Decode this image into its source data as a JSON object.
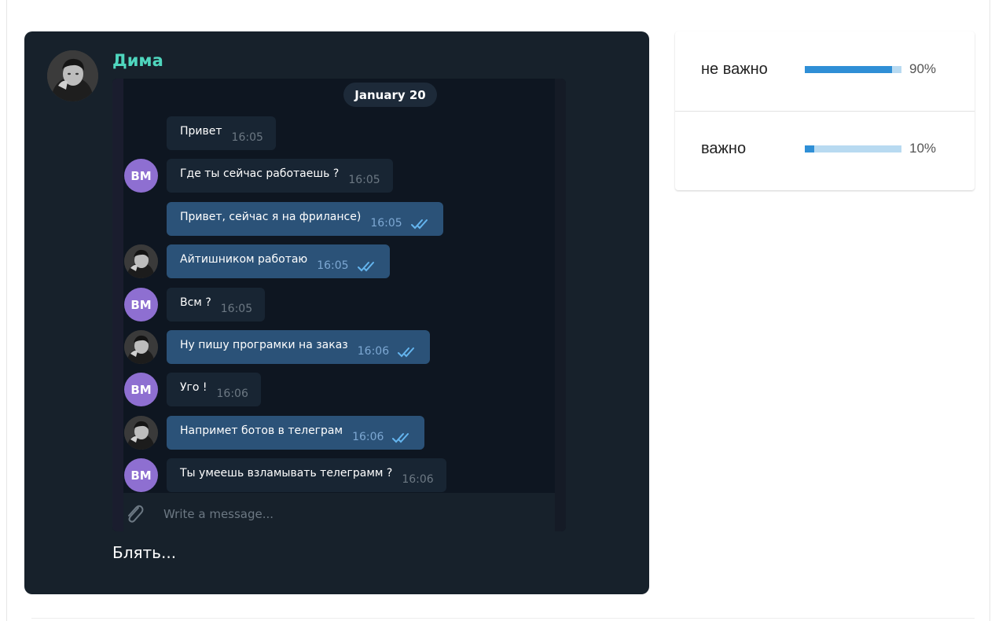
{
  "post": {
    "author": "Дима",
    "caption": "Блять...",
    "avatar_icon": "user-photo-icon",
    "screenshot": {
      "date": "January 20",
      "messages": [
        {
          "side": "in",
          "text": "Привет",
          "time": "16:05",
          "avatar": "none"
        },
        {
          "side": "in",
          "text": "Где ты сейчас работаешь ?",
          "time": "16:05",
          "avatar": "initials",
          "initials": "ВМ"
        },
        {
          "side": "out",
          "text": "Привет, сейчас я на фрилансе)",
          "time": "16:05",
          "avatar": "none",
          "read": true
        },
        {
          "side": "out",
          "text": "Айтишником работаю",
          "time": "16:05",
          "avatar": "photo",
          "read": true
        },
        {
          "side": "in",
          "text": "Всм ?",
          "time": "16:05",
          "avatar": "initials",
          "initials": "ВМ"
        },
        {
          "side": "out",
          "text": "Ну пишу програмки на заказ",
          "time": "16:06",
          "avatar": "photo",
          "read": true
        },
        {
          "side": "in",
          "text": "Уго !",
          "time": "16:06",
          "avatar": "initials",
          "initials": "ВМ"
        },
        {
          "side": "out",
          "text": "Напримет ботов в телеграм",
          "time": "16:06",
          "avatar": "photo",
          "read": true
        },
        {
          "side": "in",
          "text": "Ты умеешь взламывать телеграмм ?",
          "time": "16:06",
          "avatar": "initials",
          "initials": "ВМ"
        }
      ],
      "input_placeholder": "Write a message...",
      "attach_icon": "paperclip-icon",
      "read_icon": "double-check-icon"
    }
  },
  "poll": {
    "options": [
      {
        "label": "не важно",
        "percent_text": "90%",
        "fraction": 0.9
      },
      {
        "label": "важно",
        "percent_text": "10%",
        "fraction": 0.1
      }
    ]
  },
  "colors": {
    "card_bg": "#17212b",
    "author": "#4fd6be",
    "bubble_in": "#182533",
    "bubble_out": "#2b5278",
    "initials_avatar": "#8e6fd1",
    "poll_fill": "#2f8fd6",
    "poll_track": "#b8daf1"
  }
}
